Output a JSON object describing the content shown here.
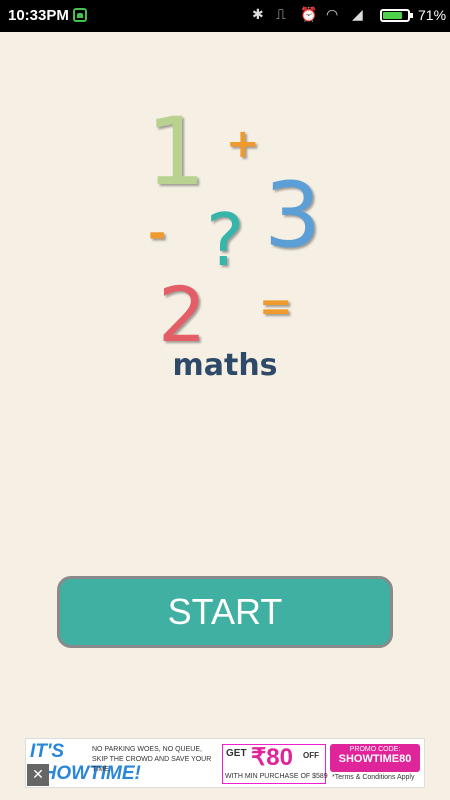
{
  "status_bar": {
    "time": "10:33PM",
    "battery_percent": 71,
    "battery_text": "71%",
    "icons": [
      "app-notification-icon",
      "bluetooth-icon",
      "vibrate-icon",
      "alarm-icon",
      "wifi-icon",
      "signal-icon",
      "battery-icon"
    ]
  },
  "logo": {
    "one": "1",
    "plus": "+",
    "three": "3",
    "minus": "-",
    "question": "?",
    "two": "2",
    "equals": "=",
    "title": "maths"
  },
  "start_button": {
    "label": "START"
  },
  "ad": {
    "headline": "IT'S SHOWTIME!",
    "subtext": "NO PARKING WOES, NO QUEUE, SKIP THE CROWD AND SAVE YOUR TIME.",
    "get": "GET",
    "amount": "₹80",
    "off": "OFF",
    "min_purchase": "WITH MIN PURCHASE OF $589",
    "promo_label": "PROMO CODE:",
    "promo_code": "SHOWTIME80",
    "terms": "*Terms & Conditions Apply",
    "close": "✕"
  },
  "colors": {
    "background": "#f5efe4",
    "button": "#3fb0a1",
    "title": "#2e4a68"
  }
}
